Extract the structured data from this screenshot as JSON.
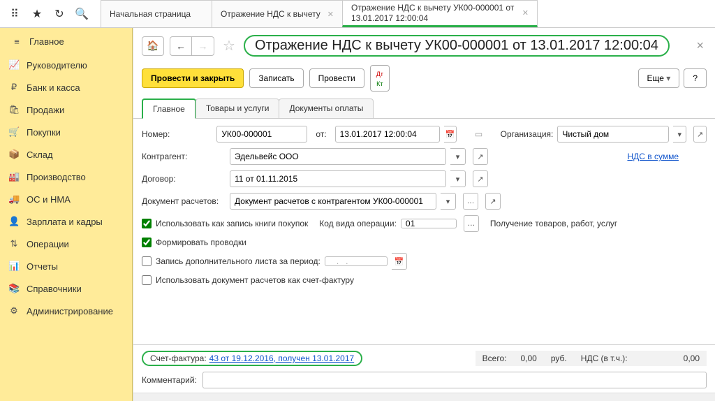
{
  "topTabs": [
    {
      "label": "Начальная страница",
      "closable": false
    },
    {
      "label": "Отражение НДС к вычету",
      "closable": true
    },
    {
      "label": "Отражение НДС к вычету УК00-000001 от 13.01.2017 12:00:04",
      "closable": true,
      "active": true
    }
  ],
  "sidebar": {
    "items": [
      {
        "icon": "≡",
        "label": "Главное"
      },
      {
        "icon": "↗",
        "label": "Руководителю"
      },
      {
        "icon": "₽",
        "label": "Банк и касса"
      },
      {
        "icon": "🛍",
        "label": "Продажи"
      },
      {
        "icon": "🛒",
        "label": "Покупки"
      },
      {
        "icon": "📦",
        "label": "Склад"
      },
      {
        "icon": "🏭",
        "label": "Производство"
      },
      {
        "icon": "🚚",
        "label": "ОС и НМА"
      },
      {
        "icon": "👤",
        "label": "Зарплата и кадры"
      },
      {
        "icon": "⇅",
        "label": "Операции"
      },
      {
        "icon": "📊",
        "label": "Отчеты"
      },
      {
        "icon": "📚",
        "label": "Справочники"
      },
      {
        "icon": "⚙",
        "label": "Администрирование"
      }
    ]
  },
  "page": {
    "title": "Отражение НДС к вычету УК00-000001 от 13.01.2017 12:00:04"
  },
  "toolbar": {
    "post_close": "Провести и закрыть",
    "save": "Записать",
    "post": "Провести",
    "dtkt": "Дт\nКт",
    "more": "Еще",
    "help": "?"
  },
  "subtabs": {
    "main": "Главное",
    "goods": "Товары и услуги",
    "paydocs": "Документы оплаты"
  },
  "form": {
    "number_label": "Номер:",
    "number_value": "УК00-000001",
    "from_label": "от:",
    "date_value": "13.01.2017 12:00:04",
    "org_label": "Организация:",
    "org_value": "Чистый дом",
    "contragent_label": "Контрагент:",
    "contragent_value": "Эдельвейс ООО",
    "vat_link": "НДС в сумме",
    "contract_label": "Договор:",
    "contract_value": "11 от 01.11.2015",
    "settle_doc_label": "Документ расчетов:",
    "settle_doc_value": "Документ расчетов с контрагентом УК00-000001",
    "chk_purchase_book": "Использовать как запись книги покупок",
    "op_code_label": "Код вида операции:",
    "op_code_value": "01",
    "op_code_desc": "Получение товаров, работ, услуг",
    "chk_postings": "Формировать проводки",
    "chk_extra_sheet": "Запись дополнительного листа за период:",
    "extra_sheet_date": "   .   .",
    "chk_use_as_invoice": "Использовать документ расчетов как счет-фактуру"
  },
  "footer": {
    "sf_label": "Счет-фактура:",
    "sf_link": "43 от 19.12.2016, получен 13.01.2017",
    "total_label": "Всего:",
    "total_value": "0,00",
    "currency": "руб.",
    "vat_inc_label": "НДС (в т.ч.):",
    "vat_inc_value": "0,00",
    "comment_label": "Комментарий:",
    "comment_value": ""
  }
}
